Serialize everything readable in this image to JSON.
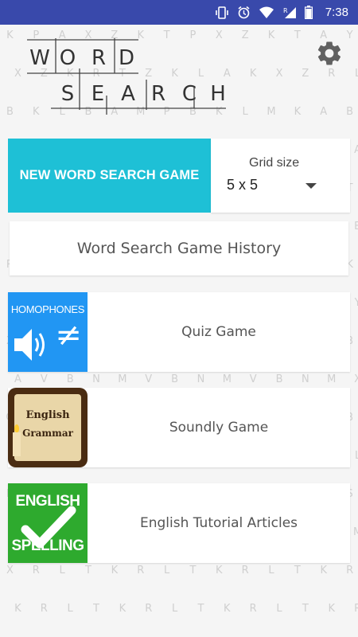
{
  "status_bar": {
    "time": "7:38"
  },
  "logo": {
    "word1": [
      "W",
      "O",
      "R",
      "D"
    ],
    "word2": [
      "S",
      "E",
      "A",
      "R",
      "C",
      "H"
    ]
  },
  "background_letters": [
    "K P A X Z K T P X Z K T A Y",
    "X Z K R T Z K L A K X Z R L",
    "B K L B A M P B K L M K A B",
    "P Q S A X B O Q S A B Q S A",
    "L Z K P X K T P K L Z K R T",
    "B O Q S A B Q S A R Q S A B",
    "R N M V B N M V B N M V B K",
    "K P A X Z K T P X Z K T A Y",
    "X B N M V B N M V B N M V B",
    "A V B N M V B N M V B N M X",
    "Q S A B O Q S A B O Q S A B",
    "R L T K R L T K R L T K R L",
    "B O Q S A B O Q S A B O Q S",
    "N M V B N M V B N M V B N M",
    "X R L T K R L T K R L T K R",
    "K R L T K R L T K R L T K R"
  ],
  "new_game": {
    "label": "NEW WORD SEARCH GAME"
  },
  "grid_size": {
    "label": "Grid size",
    "value": "5 x 5"
  },
  "history": {
    "label": "Word Search Game History"
  },
  "apps": [
    {
      "label": "Quiz Game",
      "thumb_text": "HOMOPHONES",
      "thumb_symbol": "≠",
      "thumb_color": "#2196f3"
    },
    {
      "label": "Soundly Game",
      "thumb_line1": "English",
      "thumb_line2": "Grammar",
      "thumb_color": "#5d3a1a"
    },
    {
      "label": "English Tutorial Articles",
      "thumb_line1": "ENGLISH",
      "thumb_line2": "SPELLING",
      "thumb_color": "#2eaa2e"
    }
  ],
  "colors": {
    "status_bar": "#3949ab",
    "accent": "#1ec0d6",
    "background": "#f5f5f5"
  }
}
